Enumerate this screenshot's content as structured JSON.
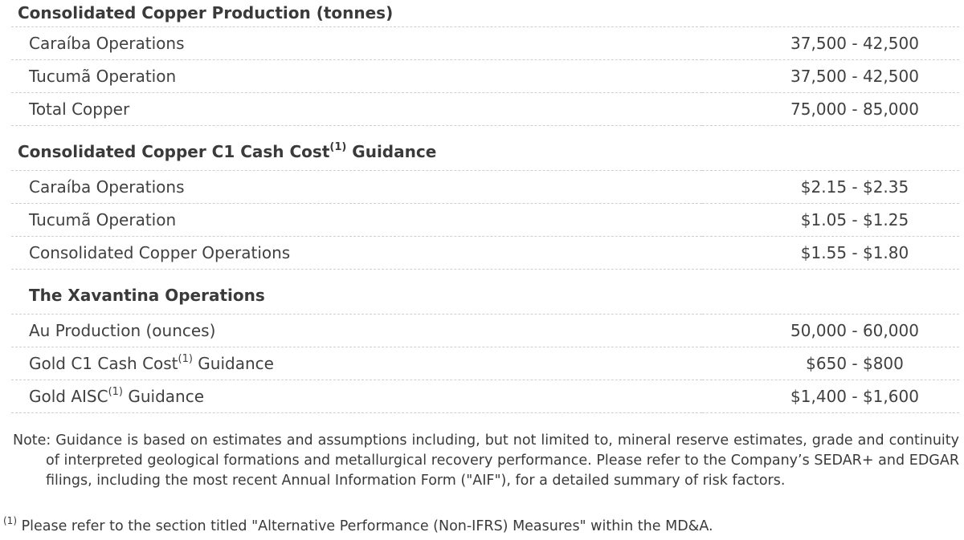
{
  "sections": [
    {
      "title": "Consolidated Copper Production (tonnes)",
      "rows": [
        {
          "label": "Caraíba Operations",
          "value": "37,500 - 42,500"
        },
        {
          "label": "Tucumã Operation",
          "value": "37,500 - 42,500"
        },
        {
          "label": "Total Copper",
          "value": "75,000 - 85,000"
        }
      ]
    },
    {
      "title": "Consolidated Copper C1 Cash Cost",
      "title_sup": "(1)",
      "title_suffix": " Guidance",
      "rows": [
        {
          "label": "Caraíba Operations",
          "value": "$2.15 - $2.35"
        },
        {
          "label": "Tucumã Operation",
          "value": "$1.05 - $1.25"
        },
        {
          "label": "Consolidated Copper Operations",
          "value": "$1.55 - $1.80"
        }
      ]
    },
    {
      "title": "The Xavantina Operations",
      "rows": [
        {
          "label": "Au Production (ounces)",
          "value": "50,000 - 60,000"
        },
        {
          "label": "Gold C1 Cash Cost",
          "label_sup": "(1)",
          "label_suffix": " Guidance",
          "value": "$650 - $800"
        },
        {
          "label": "Gold AISC",
          "label_sup": "(1)",
          "label_suffix": " Guidance",
          "value": "$1,400 - $1,600"
        }
      ]
    }
  ],
  "note": "Note: Guidance is based on estimates and assumptions including, but not limited to, mineral reserve estimates, grade and continuity of interpreted geological formations and metallurgical recovery performance. Please refer to the Company’s SEDAR+ and EDGAR filings, including the most recent Annual Information Form (\"AIF\"), for a detailed summary of risk factors.",
  "footnote": {
    "marker": "(1)",
    "text": " Please refer to the section titled \"Alternative Performance (Non-IFRS) Measures\" within the MD&A."
  }
}
